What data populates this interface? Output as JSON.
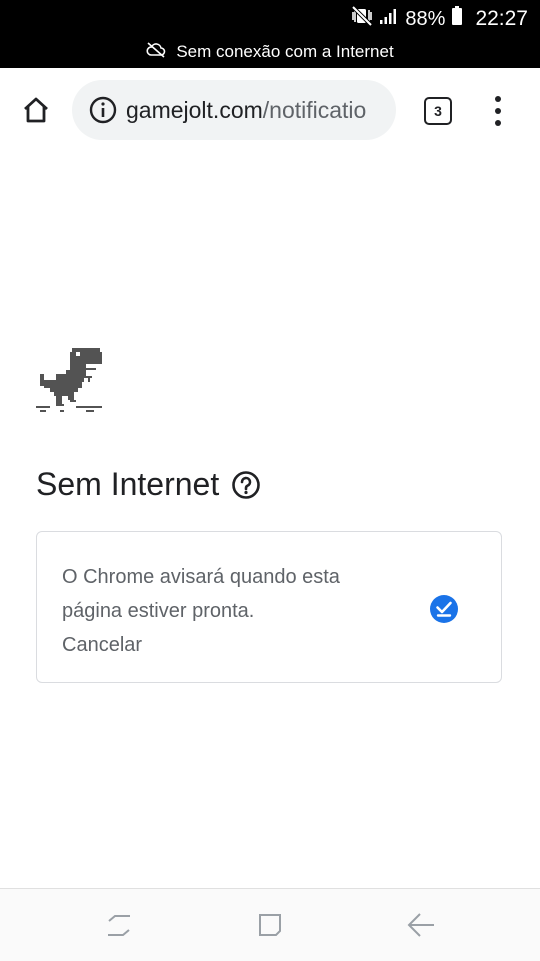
{
  "status_bar": {
    "battery": "88%",
    "time": "22:27",
    "offline_message": "Sem conexão com a Internet",
    "icons": [
      "mute-vibrate-icon",
      "signal-icon",
      "battery-icon",
      "cloud-off-icon"
    ]
  },
  "toolbar": {
    "url_domain": "gamejolt.com",
    "url_path": "/notificatio",
    "tab_count": "3",
    "icons": [
      "home-icon",
      "info-icon",
      "tab-switcher-icon",
      "more-vert-icon"
    ]
  },
  "error_page": {
    "title": "Sem Internet",
    "card_message": "O Chrome avisará quando esta página estiver pronta.",
    "cancel_label": "Cancelar",
    "accent_color": "#1a73e8",
    "icons": [
      "dino-icon",
      "help-icon",
      "check-circle-icon"
    ]
  },
  "nav_bar": {
    "icons": [
      "recent-apps-icon",
      "home-nav-icon",
      "back-icon"
    ]
  }
}
